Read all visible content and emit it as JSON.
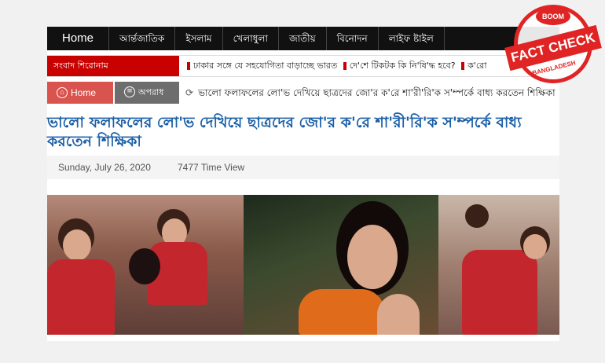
{
  "nav": {
    "items": [
      "Home",
      "আর্ন্তজাতিক",
      "ইসলাম",
      "খেলাধুলা",
      "জাতীয়",
      "বিনোদন",
      "লাইফ ষ্টাইল"
    ]
  },
  "ticker": {
    "label": "সংবাদ শিরোনাম",
    "headlines": [
      "ঢাকার সঙ্গে যে সহযোগিতা বাড়াচ্ছে ভারত",
      "দে'শে টিকটক কি নি'ষি'দ্ধ হবে?",
      "ক'রো"
    ]
  },
  "breadcrumb": {
    "home_label": "Home",
    "category_label": "অপরাধ",
    "current_title": "ভালো ফলাফলের লো'ভ দেখিয়ে ছাত্রদের জো'র ক'রে শা'রী'রি'ক স'ম্পর্কে বাধ্য করতেন শিক্ষিকা"
  },
  "article": {
    "headline": "ভালো ফলাফলের লো'ভ দেখিয়ে ছাত্রদের জো'র ক'রে শা'রী'রি'ক স'ম্পর্কে বাধ্য করতেন শিক্ষিকা",
    "date": "Sunday, July 26, 2020",
    "views": "7477 Time View"
  },
  "badge": {
    "top": "BOOM",
    "main": "FACT CHECK",
    "bottom": "BANGLADESH"
  },
  "colors": {
    "nav_bg": "#111111",
    "ticker_label_bg": "#c80000",
    "headline": "#1a5fa7",
    "home_button": "#d9534f",
    "badge": "#e02424"
  }
}
